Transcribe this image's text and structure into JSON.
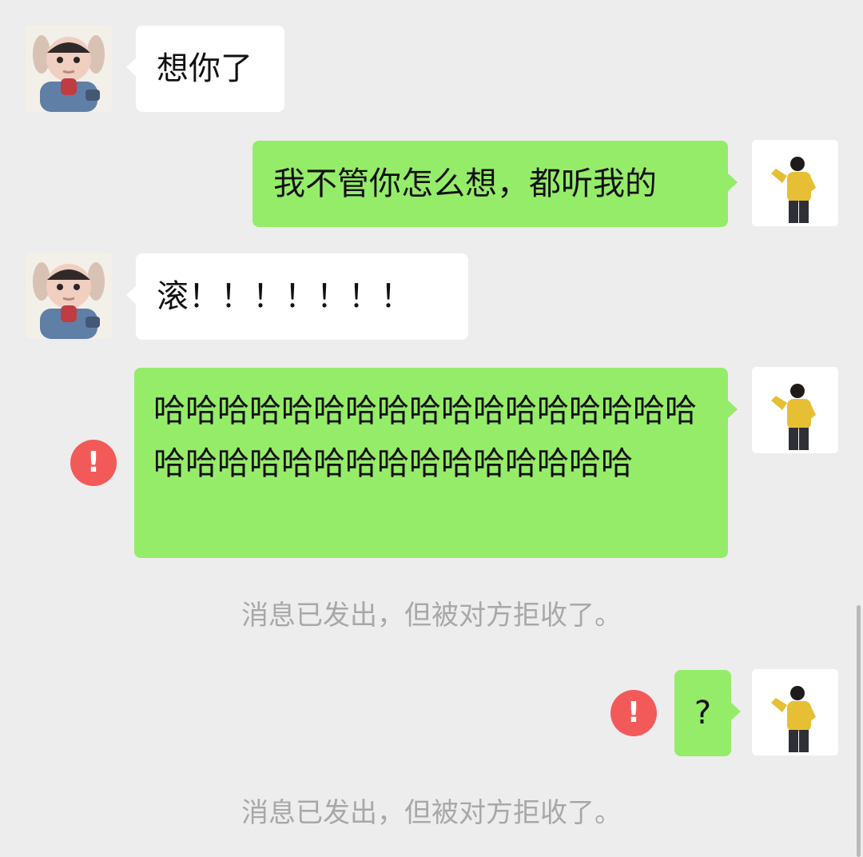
{
  "conversation": {
    "messages": [
      {
        "direction": "incoming",
        "text": "想你了",
        "avatar_icon": "baby-avatar-icon"
      },
      {
        "direction": "outgoing",
        "text": "我不管你怎么想，都听我的",
        "avatar_icon": "person-yellow-shirt-avatar-icon"
      },
      {
        "direction": "incoming",
        "text": "滚！！！！！！！",
        "avatar_icon": "baby-avatar-icon"
      },
      {
        "direction": "outgoing",
        "text": "哈哈哈哈哈哈哈哈哈哈哈哈哈哈哈哈哈哈哈哈哈哈哈哈哈哈哈哈哈哈哈哈",
        "avatar_icon": "person-yellow-shirt-avatar-icon",
        "status_icon": "red-exclamation-icon",
        "status_symbol": "!"
      },
      {
        "direction": "outgoing",
        "text": "?",
        "avatar_icon": "person-yellow-shirt-avatar-icon",
        "status_icon": "red-exclamation-icon",
        "status_symbol": "!"
      }
    ],
    "system_notes": [
      "消息已发出，但被对方拒收了。",
      "消息已发出，但被对方拒收了。"
    ]
  },
  "colors": {
    "background": "#ededed",
    "incoming_bubble": "#ffffff",
    "outgoing_bubble": "#95ec69",
    "error_badge": "#f25a5a",
    "system_text": "#a8a8a8"
  }
}
